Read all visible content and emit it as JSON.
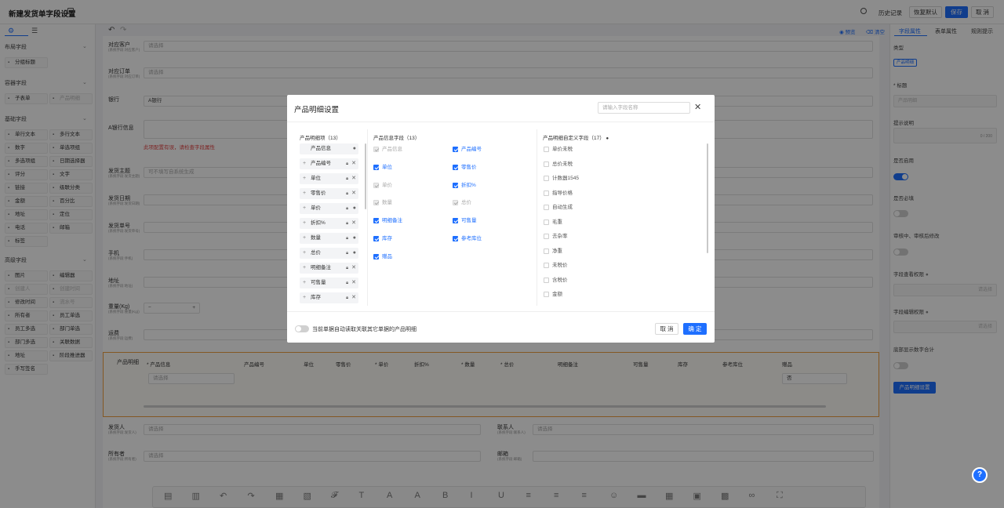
{
  "header": {
    "title": "新建发货单字段设置",
    "history": "历史记录",
    "restore": "恢复默认",
    "save": "保存",
    "cancel": "取 消"
  },
  "sidebar": {
    "sections": [
      {
        "title": "布局字段",
        "items": [
          {
            "label": "分组标题",
            "icon": "group-icon"
          }
        ]
      },
      {
        "title": "容器字段",
        "items": [
          {
            "label": "子表单",
            "icon": "table-icon"
          },
          {
            "label": "产品明细",
            "icon": "list-icon",
            "disabled": true
          }
        ]
      },
      {
        "title": "基础字段",
        "items": [
          {
            "label": "单行文本",
            "icon": "text-icon"
          },
          {
            "label": "多行文本",
            "icon": "textarea-icon"
          },
          {
            "label": "数字",
            "icon": "number-icon"
          },
          {
            "label": "单选项组",
            "icon": "radio-icon"
          },
          {
            "label": "多选项组",
            "icon": "checkbox-icon"
          },
          {
            "label": "日期选择器",
            "icon": "date-icon"
          },
          {
            "label": "评分",
            "icon": "star-icon"
          },
          {
            "label": "文字",
            "icon": "font-icon"
          },
          {
            "label": "链接",
            "icon": "link-icon"
          },
          {
            "label": "级联分类",
            "icon": "cascade-icon"
          },
          {
            "label": "金额",
            "icon": "money-icon"
          },
          {
            "label": "百分比",
            "icon": "percent-icon"
          },
          {
            "label": "地址",
            "icon": "pin-icon"
          },
          {
            "label": "定位",
            "icon": "locate-icon"
          },
          {
            "label": "电话",
            "icon": "phone-icon"
          },
          {
            "label": "邮箱",
            "icon": "mail-icon"
          },
          {
            "label": "标签",
            "icon": "tag-icon"
          }
        ]
      },
      {
        "title": "高级字段",
        "items": [
          {
            "label": "图片",
            "icon": "image-icon"
          },
          {
            "label": "编辑器",
            "icon": "editor-icon"
          },
          {
            "label": "创建人",
            "icon": "user-icon",
            "disabled": true
          },
          {
            "label": "创建时间",
            "icon": "clock-icon",
            "disabled": true
          },
          {
            "label": "修改时间",
            "icon": "clock-icon"
          },
          {
            "label": "流水号",
            "icon": "serial-icon",
            "disabled": true
          },
          {
            "label": "所有者",
            "icon": "owner-icon"
          },
          {
            "label": "员工单选",
            "icon": "user-icon"
          },
          {
            "label": "员工多选",
            "icon": "users-icon"
          },
          {
            "label": "部门单选",
            "icon": "dept-icon"
          },
          {
            "label": "部门多选",
            "icon": "dept-icon"
          },
          {
            "label": "关联数据",
            "icon": "relation-icon"
          },
          {
            "label": "地址",
            "icon": "pin-icon"
          },
          {
            "label": "阶段推进器",
            "icon": "stage-icon"
          },
          {
            "label": "手写签名",
            "icon": "sign-icon"
          }
        ]
      }
    ]
  },
  "canvas": {
    "preview": "预览",
    "clear": "清空",
    "fields": [
      {
        "label": "对应客户",
        "sub": "(系统字段:对应客户)",
        "placeholder": "请选择"
      },
      {
        "label": "对应订单",
        "sub": "(系统字段:对应订单)",
        "placeholder": "请选择"
      },
      {
        "label": "银行",
        "value": "A银行"
      },
      {
        "label": "A银行信息",
        "warning": "此项配置有误，请检查字段属性"
      },
      {
        "label": "发货主题",
        "sub": "(系统字段:发货主题)",
        "placeholder": "可不填写自系统生成"
      },
      {
        "label": "发货日期",
        "sub": "(系统字段:发货日期)"
      },
      {
        "label": "发货单号",
        "sub": "(系统字段:发货单号)"
      },
      {
        "label": "手机",
        "sub": "(系统字段:手机)"
      },
      {
        "label": "地址",
        "sub": "(系统字段:地址)"
      },
      {
        "label": "重量(Kg)",
        "sub": "(系统字段:重量(Kg))"
      },
      {
        "label": "运费",
        "sub": "(系统字段:运费)"
      }
    ],
    "product_detail": {
      "label": "产品明细",
      "columns": [
        "* 产品信息",
        "产品编号",
        "单位",
        "零售价",
        "* 单价",
        "折扣%",
        "* 数量",
        "* 总价",
        "明细备注",
        "可售量",
        "库存",
        "参考库位",
        "赠品"
      ],
      "select_placeholder": "请选择",
      "gift_value": "否"
    },
    "bottom_fields": [
      {
        "label": "发货人",
        "sub": "(系统字段:发货人)",
        "placeholder": "请选择"
      },
      {
        "label": "联系人",
        "sub": "(系统字段:联系人)",
        "placeholder": "请选择"
      },
      {
        "label": "所有者",
        "sub": "(系统字段:所有者)",
        "placeholder": "请选择"
      },
      {
        "label": "邮箱",
        "sub": "(系统字段:邮箱)"
      }
    ]
  },
  "right_panel": {
    "tabs": [
      "字段属性",
      "表单属性",
      "规则提示"
    ],
    "type_label": "类型",
    "type_value": "产品明细",
    "title_label": "* 标题",
    "title_value": "产品明细",
    "hint_label": "提示说明",
    "hint_count": "0 / 200",
    "enabled_label": "是否启用",
    "required_label": "是否必填",
    "audit_label": "审核中、审核后修改",
    "view_perm_label": "字段查看权限",
    "edit_perm_label": "字段编辑权限",
    "perm_placeholder": "请选择",
    "sum_label": "底部显示数字合计",
    "setting_button": "产品明细设置"
  },
  "modal": {
    "title": "产品明细设置",
    "search_placeholder": "请输入字段名称",
    "col1_title": "产品明细项（13）",
    "col1_items": [
      {
        "label": "产品信息",
        "fixed": true
      },
      {
        "label": "产品编号"
      },
      {
        "label": "单位"
      },
      {
        "label": "零售价"
      },
      {
        "label": "单价",
        "info": true
      },
      {
        "label": "折扣%"
      },
      {
        "label": "数量",
        "info": true
      },
      {
        "label": "总价",
        "info": true
      },
      {
        "label": "明细备注"
      },
      {
        "label": "可售量"
      },
      {
        "label": "库存"
      }
    ],
    "col2_title": "产品信息字段（13）",
    "col2_items": [
      {
        "label": "产品信息",
        "state": "disabled"
      },
      {
        "label": "产品编号",
        "state": "checked"
      },
      {
        "label": "单位",
        "state": "checked"
      },
      {
        "label": "零售价",
        "state": "checked"
      },
      {
        "label": "单价",
        "state": "disabled"
      },
      {
        "label": "折扣%",
        "state": "checked"
      },
      {
        "label": "数量",
        "state": "disabled"
      },
      {
        "label": "总价",
        "state": "disabled"
      },
      {
        "label": "明细备注",
        "state": "checked"
      },
      {
        "label": "可售量",
        "state": "checked"
      },
      {
        "label": "库存",
        "state": "checked"
      },
      {
        "label": "参考库位",
        "state": "checked"
      },
      {
        "label": "赠品",
        "state": "checked"
      }
    ],
    "col3_title": "产品明细自定义字段（17）",
    "col3_items": [
      "单价未税",
      "总价未税",
      "计数器1545",
      "指导价格",
      "自动生成",
      "毛重",
      "去杂率",
      "净重",
      "未税价",
      "含税价",
      "金额"
    ],
    "toggle_label": "当前单据自动读取关联其它单据的产品明细",
    "cancel": "取 消",
    "ok": "确 定"
  }
}
